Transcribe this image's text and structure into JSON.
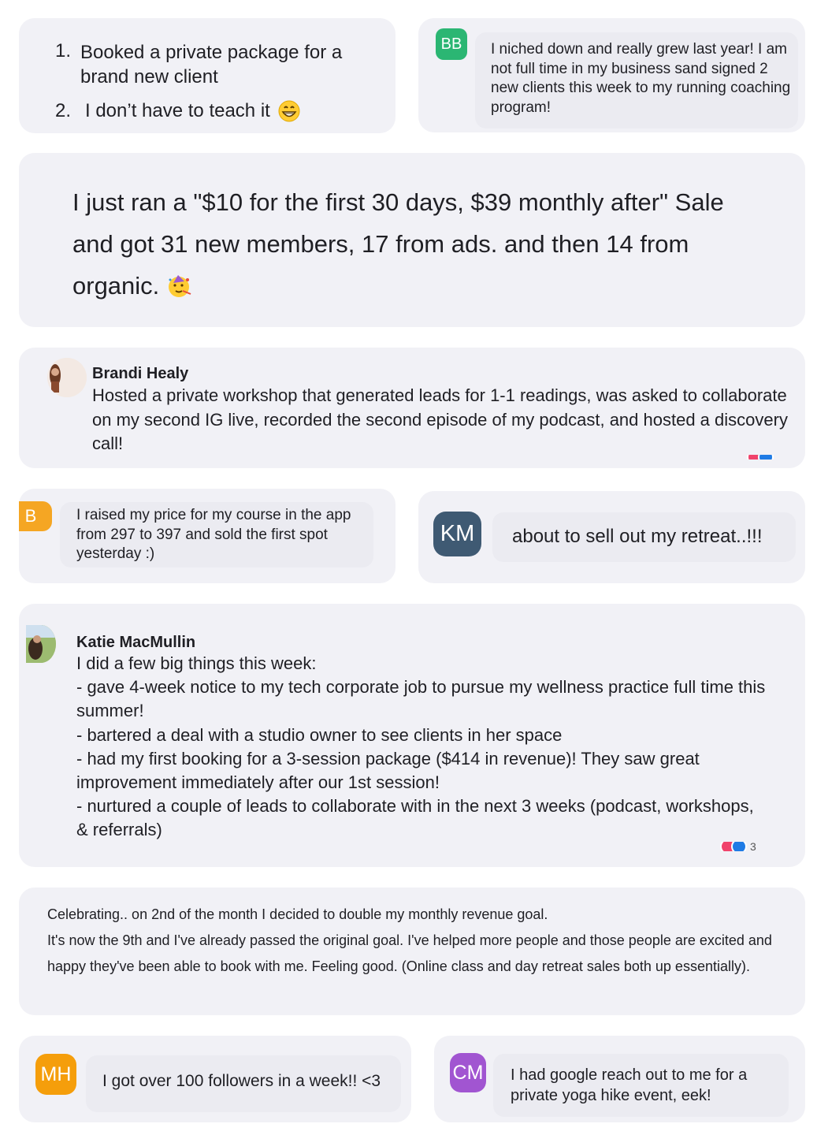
{
  "cards": {
    "c1": {
      "items": [
        {
          "num": "1.",
          "lines": [
            "Booked a private package for a",
            "brand new client"
          ]
        },
        {
          "num": "2.",
          "text": "I don’t have to teach it"
        }
      ]
    },
    "c2": {
      "initials": "BB",
      "avatar_color": "#2bb673",
      "text": "I niched down and really grew last year! I am not full time in my business sand signed 2 new clients this week to my running coaching program!"
    },
    "c3": {
      "lines": [
        "I just ran a \"$10 for the first 30 days, $39 monthly after\" Sale",
        "and got 31 new members, 17 from ads. and then 14 from",
        "organic."
      ]
    },
    "c4": {
      "name": "Brandi Healy",
      "text": "Hosted a private workshop that generated leads for 1-1 readings, was asked to collaborate on my second IG live, recorded the second episode of my podcast, and hosted a discovery call!"
    },
    "c5": {
      "initial": "B",
      "avatar_color": "#f5a623",
      "text": "I raised my price for my course in the app from 297 to 397 and sold the first spot yesterday :)"
    },
    "c6": {
      "initials": "KM",
      "avatar_color": "#3f5a73",
      "text": "about to sell out my retreat..!!!"
    },
    "c7": {
      "name": "Katie MacMullin",
      "lines": [
        "I did a few big things this week:",
        "- gave 4-week notice to my tech corporate job to pursue my wellness practice full time this summer!",
        "- bartered a deal with a studio owner to see clients in her space",
        "- had my first booking for a 3-session package ($414 in revenue)! They saw great improvement immediately after our 1st session!",
        "- nurtured a couple of leads to collaborate with in the next 3 weeks (podcast, workshops, & referrals)"
      ],
      "reaction_count": "3"
    },
    "c8": {
      "lines": [
        "Celebrating.. on 2nd of the month I decided to double my monthly revenue goal.",
        "It's now the 9th and I've already passed the original goal. I've helped more people and those people are excited and happy they've been able to book with me. Feeling good. (Online class and day retreat sales both up essentially)."
      ]
    },
    "c9": {
      "initials": "MH",
      "avatar_color": "#f59e0b",
      "text": "I got over 100 followers in a week!! <3"
    },
    "c10": {
      "initials": "CM",
      "avatar_color": "#a155d1",
      "text": "I had google reach out to me for a private yoga hike event, eek!"
    }
  },
  "icons": {
    "grin": "grinning-face-emoji",
    "party": "partying-face-emoji",
    "heart": "heart-reaction-icon",
    "thumb": "thumbs-up-reaction-icon"
  },
  "colors": {
    "card_bg": "#f1f1f6",
    "bubble_bg": "#ebebf1",
    "heart": "#f0436b",
    "thumb": "#1f7be5"
  }
}
